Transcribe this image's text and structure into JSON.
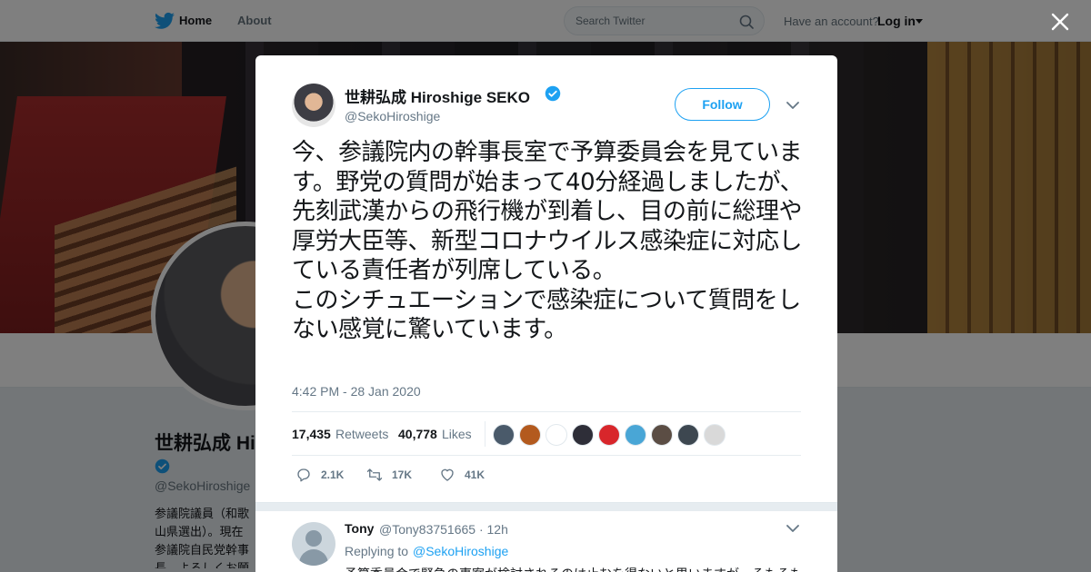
{
  "nav": {
    "home_label": "Home",
    "about_label": "About",
    "search_placeholder": "Search Twitter",
    "have_account": "Have an account?",
    "login_label": "Log in"
  },
  "profile": {
    "name": "世耕弘成 Hiroshige SEKO",
    "handle": "@SekoHiroshige",
    "bio": "参議院議員（和歌山県選出）。現在参議院自民党幹事長。よろしくお願いします。"
  },
  "tweet": {
    "author_name": "世耕弘成 Hiroshige SEKO",
    "author_handle": "@SekoHiroshige",
    "follow_label": "Follow",
    "text": "今、参議院内の幹事長室で予算委員会を見ています。野党の質問が始まって40分経過しましたが、\n先刻武漢からの飛行機が到着し、目の前に総理や厚労大臣等、新型コロナウイルス感染症に対応している責任者が列席している。\nこのシチュエーションで感染症について質問をしない感覚に驚いています。",
    "timestamp": "4:42 PM - 28 Jan 2020",
    "retweets_count": "17,435",
    "retweets_label": "Retweets",
    "likes_count": "40,778",
    "likes_label": "Likes",
    "reply_action_count": "2.1K",
    "retweet_action_count": "17K",
    "like_action_count": "41K"
  },
  "likers": [
    "#4a5a6a",
    "#b35a1e",
    "#ffffff",
    "#2e2e38",
    "#d8262b",
    "#49a6d6",
    "#5b4d44",
    "#3d4750",
    "#d9d9d9"
  ],
  "reply": {
    "name": "Tony",
    "handle_time": "@Tony83751665 · 12h",
    "replying_to_label": "Replying to",
    "replying_to_handle": "@SekoHiroshige",
    "text": "予算委員会で緊急の事案が検討されるのは止むを得ないと思いますが、そもそも"
  },
  "colors": {
    "accent": "#1da1f2",
    "text": "#14171a",
    "muted": "#657786"
  }
}
